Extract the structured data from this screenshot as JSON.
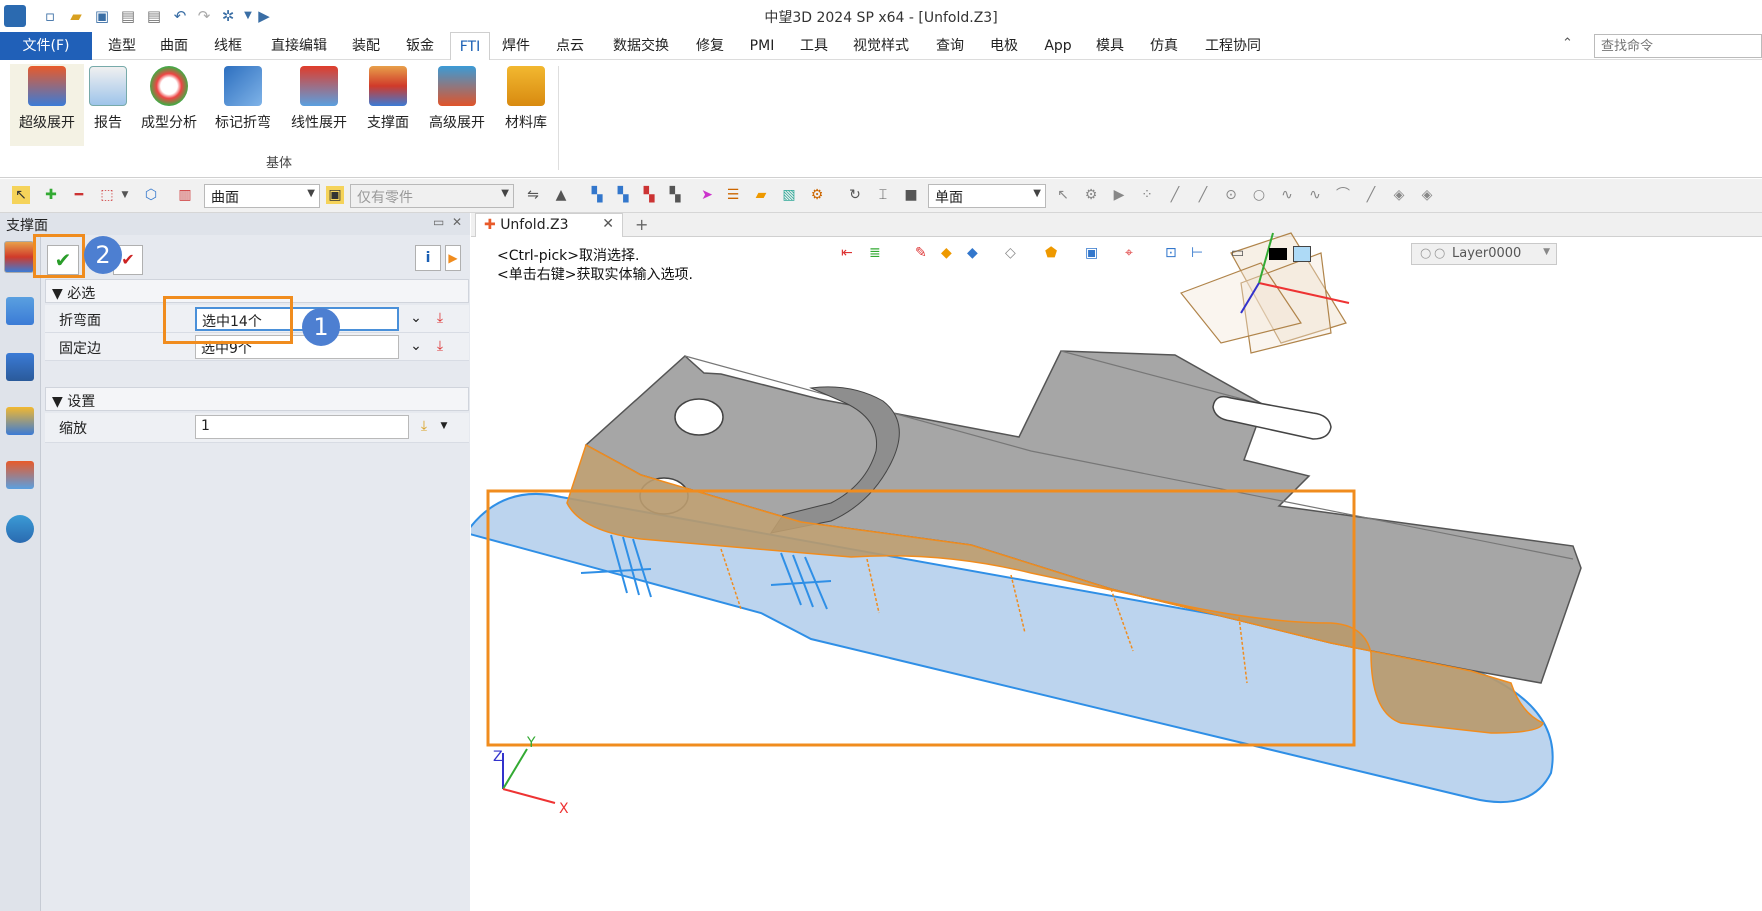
{
  "titlebar": {
    "title": "中望3D 2024 SP x64 - [Unfold.Z3]"
  },
  "menubar": {
    "file_label": "文件(F)",
    "tabs": [
      "造型",
      "曲面",
      "线框",
      "直接编辑",
      "装配",
      "钣金",
      "FTI",
      "焊件",
      "点云",
      "数据交换",
      "修复",
      "PMI",
      "工具",
      "视觉样式",
      "查询",
      "电极",
      "App",
      "模具",
      "仿真",
      "工程协同"
    ],
    "active_tab": "FTI",
    "search_placeholder": "查找命令"
  },
  "ribbon": {
    "buttons": [
      "超级展开",
      "报告",
      "成型分析",
      "标记折弯",
      "线性展开",
      "支撑面",
      "高级展开",
      "材料库"
    ],
    "group_label": "基体"
  },
  "toolbar": {
    "filter_select": "曲面",
    "scope_select": "仅有零件",
    "view_select": "单面"
  },
  "panel": {
    "title": "支撑面",
    "section_required": "必选",
    "section_settings": "设置",
    "fields": {
      "bend_face_label": "折弯面",
      "bend_face_value": "选中14个",
      "fixed_edge_label": "固定边",
      "fixed_edge_value": "选中9个",
      "scale_label": "缩放",
      "scale_value": "1"
    },
    "info_label": "i"
  },
  "annotations": {
    "badge1": "1",
    "badge2": "2"
  },
  "document": {
    "tab_label": "Unfold.Z3",
    "hint_line1": "<Ctrl-pick>取消选择.",
    "hint_line2": "<单击右键>获取实体输入选项.",
    "layer": "Layer0000",
    "axes": {
      "x": "X",
      "y": "Y",
      "z": "Z"
    }
  },
  "colors": {
    "accent": "#2060b8",
    "annotation": "#f08c1e",
    "badge": "#4d7fd1",
    "part": "#a6a6a6",
    "selected_face": "#b89a6e",
    "support_surface": "#bcd4ee"
  }
}
